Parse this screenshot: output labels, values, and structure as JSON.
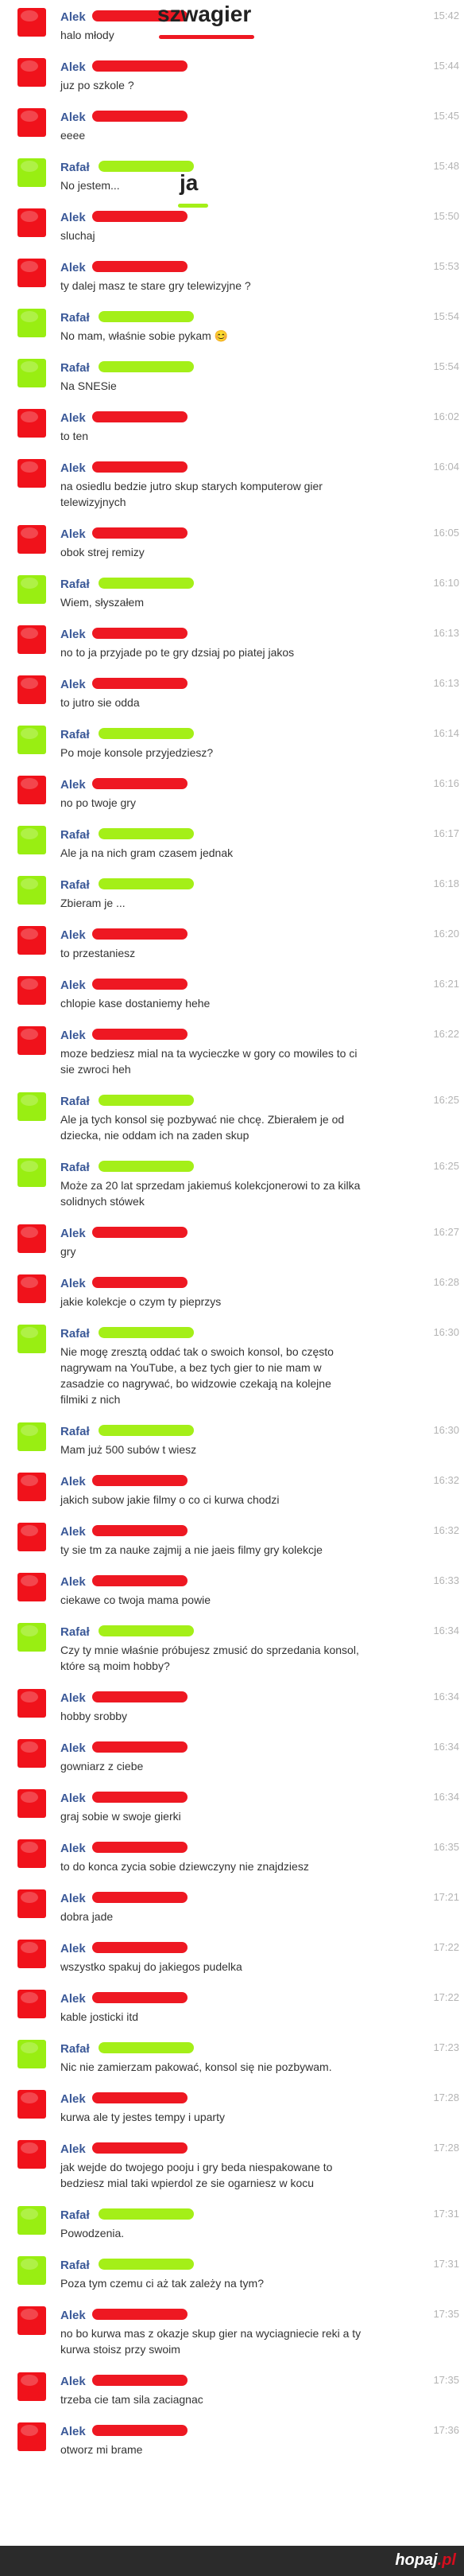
{
  "annotations": {
    "szwagier": "szwagier",
    "ja": "ja"
  },
  "messages": [
    {
      "sender": "Alek",
      "time": "15:42",
      "lines": [
        "halo młody"
      ]
    },
    {
      "sender": "Alek",
      "time": "15:44",
      "lines": [
        "juz po szkole ?"
      ]
    },
    {
      "sender": "Alek",
      "time": "15:45",
      "lines": [
        "eeee"
      ]
    },
    {
      "sender": "Rafał",
      "time": "15:48",
      "lines": [
        "No jestem..."
      ]
    },
    {
      "sender": "Alek",
      "time": "15:50",
      "lines": [
        "sluchaj"
      ]
    },
    {
      "sender": "Alek",
      "time": "15:53",
      "lines": [
        "ty dalej masz te stare gry telewizyjne ?"
      ]
    },
    {
      "sender": "Rafał",
      "time": "15:54",
      "lines": [
        "No mam, właśnie sobie pykam 😊"
      ]
    },
    {
      "sender": "Rafał",
      "time": "15:54",
      "lines": [
        "Na SNESie"
      ]
    },
    {
      "sender": "Alek",
      "time": "16:02",
      "lines": [
        "to ten"
      ]
    },
    {
      "sender": "Alek",
      "time": "16:04",
      "lines": [
        "na osiedlu bedzie jutro skup starych komputerow gier",
        "telewizyjnych"
      ]
    },
    {
      "sender": "Alek",
      "time": "16:05",
      "lines": [
        "obok strej remizy"
      ]
    },
    {
      "sender": "Rafał",
      "time": "16:10",
      "lines": [
        "Wiem, słyszałem"
      ]
    },
    {
      "sender": "Alek",
      "time": "16:13",
      "lines": [
        "no to ja przyjade po te gry dzsiaj po piatej jakos"
      ]
    },
    {
      "sender": "Alek",
      "time": "16:13",
      "lines": [
        "to jutro sie odda"
      ]
    },
    {
      "sender": "Rafał",
      "time": "16:14",
      "lines": [
        "Po moje konsole przyjedziesz?"
      ]
    },
    {
      "sender": "Alek",
      "time": "16:16",
      "lines": [
        "no po twoje gry"
      ]
    },
    {
      "sender": "Rafał",
      "time": "16:17",
      "lines": [
        "Ale ja na nich gram czasem jednak"
      ]
    },
    {
      "sender": "Rafał",
      "time": "16:18",
      "lines": [
        "Zbieram je ..."
      ]
    },
    {
      "sender": "Alek",
      "time": "16:20",
      "lines": [
        "to przestaniesz"
      ]
    },
    {
      "sender": "Alek",
      "time": "16:21",
      "lines": [
        "chlopie kase dostaniemy hehe"
      ]
    },
    {
      "sender": "Alek",
      "time": "16:22",
      "lines": [
        "moze bedziesz mial na ta wycieczke w gory co mowiles to ci",
        "sie zwroci heh"
      ]
    },
    {
      "sender": "Rafał",
      "time": "16:25",
      "lines": [
        "Ale ja tych konsol się pozbywać nie chcę. Zbierałem je od",
        "dziecka, nie oddam ich na zaden skup"
      ]
    },
    {
      "sender": "Rafał",
      "time": "16:25",
      "lines": [
        "Może za 20 lat sprzedam jakiemuś kolekcjonerowi to za kilka",
        "solidnych stówek"
      ]
    },
    {
      "sender": "Alek",
      "time": "16:27",
      "lines": [
        "gry"
      ]
    },
    {
      "sender": "Alek",
      "time": "16:28",
      "lines": [
        "jakie kolekcje o czym ty pieprzys"
      ]
    },
    {
      "sender": "Rafał",
      "time": "16:30",
      "lines": [
        "Nie mogę zresztą oddać tak o swoich konsol, bo często",
        "nagrywam na YouTube, a bez tych gier to nie mam w",
        "zasadzie co nagrywać, bo widzowie czekają na kolejne",
        "filmiki z nich"
      ]
    },
    {
      "sender": "Rafał",
      "time": "16:30",
      "lines": [
        "Mam już 500 subów t wiesz"
      ]
    },
    {
      "sender": "Alek",
      "time": "16:32",
      "lines": [
        "jakich subow jakie filmy o co ci kurwa chodzi"
      ]
    },
    {
      "sender": "Alek",
      "time": "16:32",
      "lines": [
        "ty sie tm za nauke zajmij a nie jaeis filmy gry kolekcje"
      ]
    },
    {
      "sender": "Alek",
      "time": "16:33",
      "lines": [
        "ciekawe co twoja mama powie"
      ]
    },
    {
      "sender": "Rafał",
      "time": "16:34",
      "lines": [
        "Czy ty mnie właśnie próbujesz zmusić do sprzedania konsol,",
        "które są moim hobby?"
      ]
    },
    {
      "sender": "Alek",
      "time": "16:34",
      "lines": [
        "hobby srobby"
      ]
    },
    {
      "sender": "Alek",
      "time": "16:34",
      "lines": [
        "gowniarz z ciebe"
      ]
    },
    {
      "sender": "Alek",
      "time": "16:34",
      "lines": [
        "graj sobie w swoje gierki"
      ]
    },
    {
      "sender": "Alek",
      "time": "16:35",
      "lines": [
        "to do konca zycia sobie dziewczyny nie znajdziesz"
      ]
    },
    {
      "sender": "Alek",
      "time": "17:21",
      "lines": [
        "dobra jade"
      ]
    },
    {
      "sender": "Alek",
      "time": "17:22",
      "lines": [
        "wszystko spakuj do jakiegos pudelka"
      ]
    },
    {
      "sender": "Alek",
      "time": "17:22",
      "lines": [
        "kable josticki itd"
      ]
    },
    {
      "sender": "Rafał",
      "time": "17:23",
      "lines": [
        "Nic nie zamierzam pakować, konsol się nie pozbywam."
      ]
    },
    {
      "sender": "Alek",
      "time": "17:28",
      "lines": [
        "kurwa ale ty jestes tempy i uparty"
      ]
    },
    {
      "sender": "Alek",
      "time": "17:28",
      "lines": [
        "jak wejde do twojego pooju i gry beda niespakowane to",
        "bedziesz mial taki wpierdol ze sie ogarniesz w kocu"
      ]
    },
    {
      "sender": "Rafał",
      "time": "17:31",
      "lines": [
        "Powodzenia."
      ]
    },
    {
      "sender": "Rafał",
      "time": "17:31",
      "lines": [
        "Poza tym czemu ci aż tak zależy na tym?"
      ]
    },
    {
      "sender": "Alek",
      "time": "17:35",
      "lines": [
        "no bo kurwa mas z okazje skup gier na wyciagniecie reki a ty",
        "kurwa stoisz przy swoim"
      ]
    },
    {
      "sender": "Alek",
      "time": "17:35",
      "lines": [
        "trzeba cie tam sila zaciagnac"
      ]
    },
    {
      "sender": "Alek",
      "time": "17:36",
      "lines": [
        "otworz mi brame"
      ]
    }
  ],
  "footer": {
    "brand": "hopaj",
    "tld": ".pl"
  },
  "colors": {
    "alek": "#f0121b",
    "rafal": "#99ee12",
    "name": "#3b5998",
    "time": "#b4b4b4",
    "brand_dot": "#d50e1e"
  }
}
